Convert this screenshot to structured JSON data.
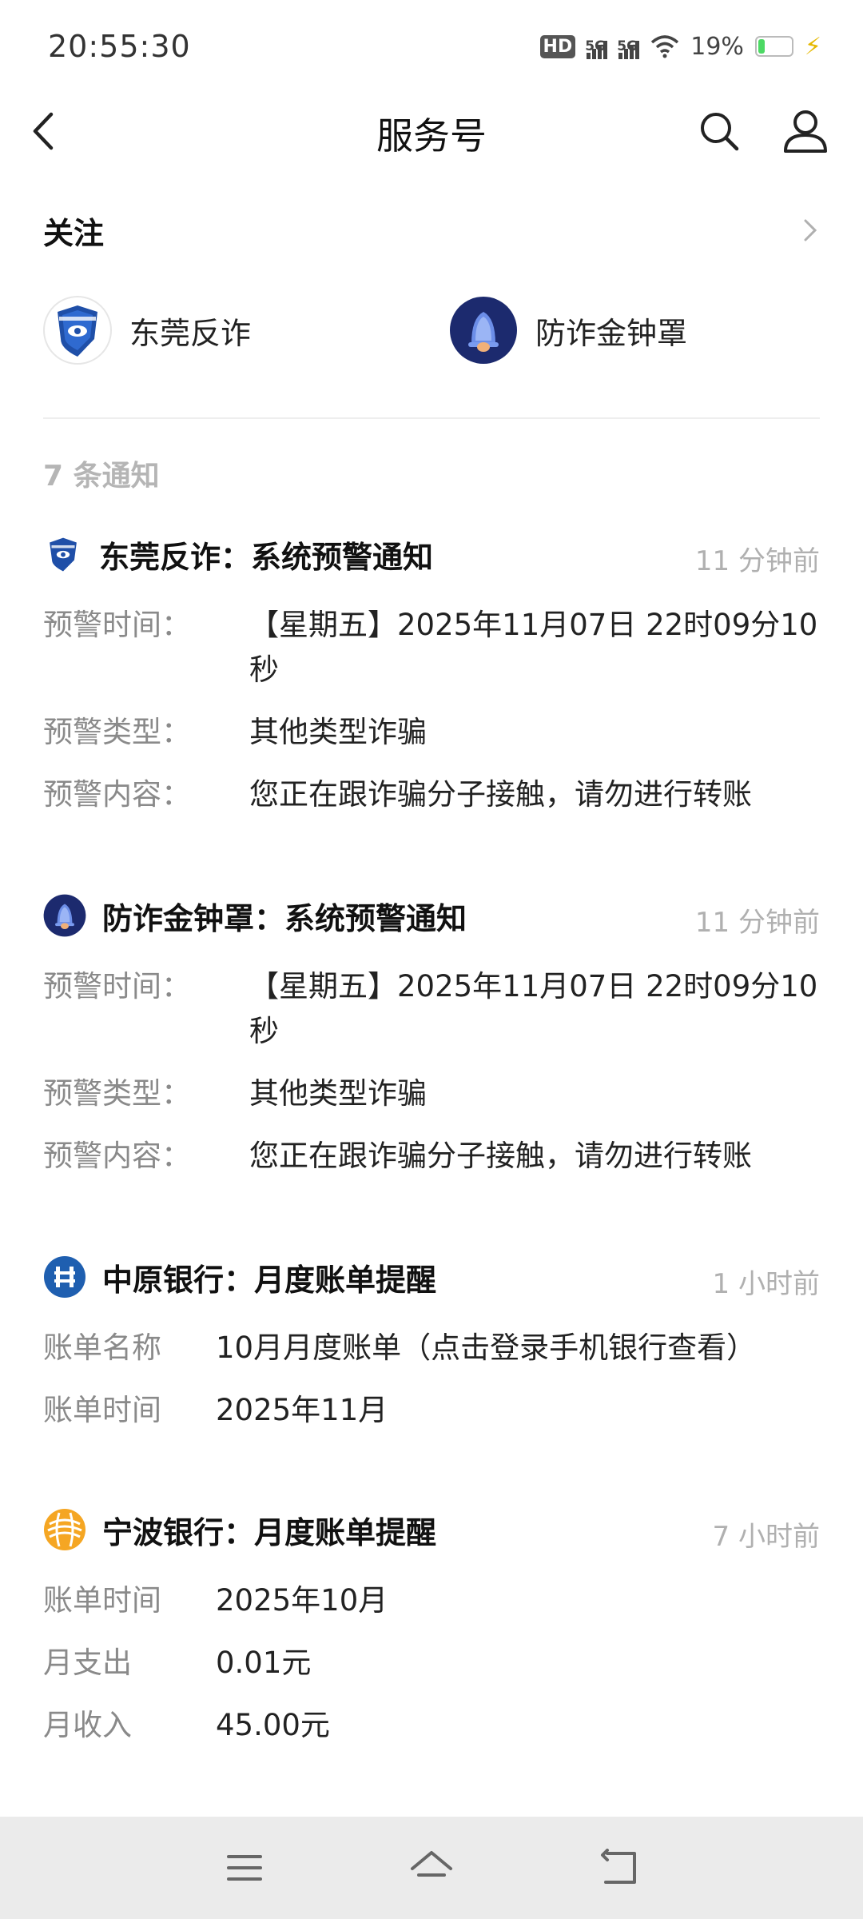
{
  "status_bar": {
    "time": "20:55:30",
    "network_1": "5G",
    "network_2": "5G",
    "battery_percent": "19%",
    "battery_level": 0.19
  },
  "nav": {
    "title": "服务号"
  },
  "follow": {
    "title": "关注",
    "accounts": [
      {
        "name": "东莞反诈"
      },
      {
        "name": "防诈金钟罩"
      }
    ]
  },
  "notice_count": "7 条通知",
  "notices": [
    {
      "title": "东莞反诈：系统预警通知",
      "time": "11 分钟前",
      "fields": [
        {
          "label": "预警时间：",
          "value": "【星期五】2025年11月07日 22时09分10秒"
        },
        {
          "label": "预警类型：",
          "value": "其他类型诈骗"
        },
        {
          "label": "预警内容：",
          "value": "您正在跟诈骗分子接触，请勿进行转账"
        }
      ]
    },
    {
      "title": "防诈金钟罩：系统预警通知",
      "time": "11 分钟前",
      "fields": [
        {
          "label": "预警时间：",
          "value": "【星期五】2025年11月07日 22时09分10秒"
        },
        {
          "label": "预警类型：",
          "value": "其他类型诈骗"
        },
        {
          "label": "预警内容：",
          "value": "您正在跟诈骗分子接触，请勿进行转账"
        }
      ]
    },
    {
      "title": "中原银行：月度账单提醒",
      "time": "1 小时前",
      "fields": [
        {
          "label": "账单名称",
          "value": "10月月度账单（点击登录手机银行查看）"
        },
        {
          "label": "账单时间",
          "value": "2025年11月"
        }
      ]
    },
    {
      "title": "宁波银行：月度账单提醒",
      "time": "7 小时前",
      "fields": [
        {
          "label": "账单时间",
          "value": "2025年10月"
        },
        {
          "label": "月支出",
          "value": "0.01元"
        },
        {
          "label": "月收入",
          "value": "45.00元"
        }
      ]
    }
  ],
  "colors": {
    "bank_zhongyuan": "#1f5fb0",
    "bank_ningbo": "#f5a623",
    "battery_fill": "#4cd964",
    "bolt": "#e5b800"
  }
}
